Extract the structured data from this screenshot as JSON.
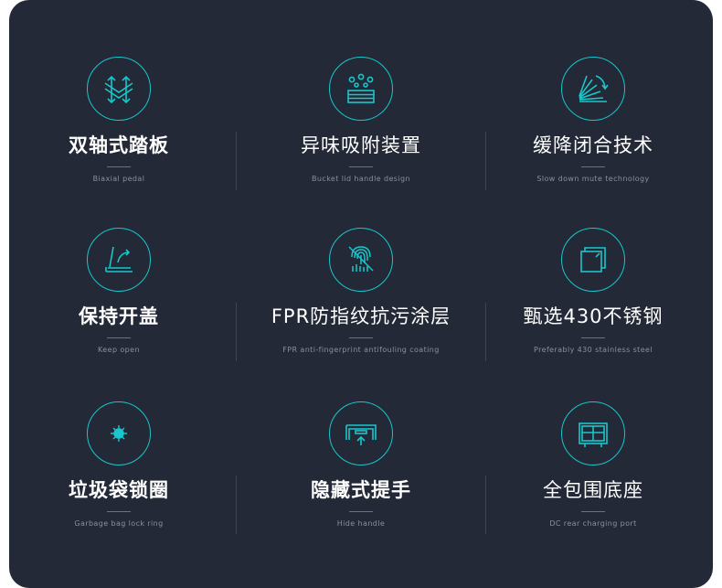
{
  "colors": {
    "background": "#232936",
    "accent": "#18c7cc",
    "title": "#ffffff",
    "subtitle": "#8a909b"
  },
  "features": [
    {
      "title": "双轴式踏板",
      "subtitle": "Biaxial pedal",
      "icon": "biaxial-pedal-icon"
    },
    {
      "title": "异味吸附装置",
      "subtitle": "Bucket lid handle design",
      "icon": "odor-absorber-icon"
    },
    {
      "title": "缓降闭合技术",
      "subtitle": "Slow down mute technology",
      "icon": "slow-close-icon"
    },
    {
      "title": "保持开盖",
      "subtitle": "Keep open",
      "icon": "keep-open-icon"
    },
    {
      "title": "FPR防指纹抗污涂层",
      "subtitle": "FPR anti-fingerprint antifouling coating",
      "icon": "fingerprint-icon"
    },
    {
      "title": "甄选430不锈钢",
      "subtitle": "Preferably 430 stainless steel",
      "icon": "stainless-steel-icon"
    },
    {
      "title": "垃圾袋锁圈",
      "subtitle": "Garbage bag lock ring",
      "icon": "lock-ring-icon"
    },
    {
      "title": "隐藏式提手",
      "subtitle": "Hide handle",
      "icon": "hidden-handle-icon"
    },
    {
      "title": "全包围底座",
      "subtitle": "DC rear charging port",
      "icon": "base-icon"
    }
  ]
}
